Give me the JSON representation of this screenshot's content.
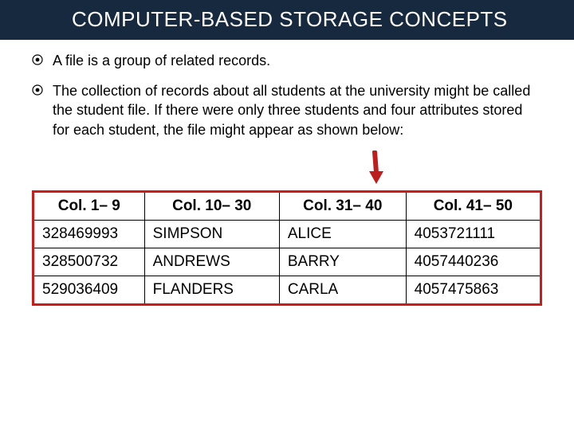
{
  "title": "COMPUTER-BASED STORAGE CONCEPTS",
  "bullets": [
    "A file is a group of related records.",
    "The collection of records about all students at the university might be called the student file. If there were only three students and four attributes stored for each student, the file might appear as shown below:"
  ],
  "table": {
    "headers": [
      "Col. 1– 9",
      "Col. 10– 30",
      "Col. 31– 40",
      "Col. 41– 50"
    ],
    "rows": [
      [
        "328469993",
        "SIMPSON",
        "ALICE",
        "4053721111"
      ],
      [
        "328500732",
        "ANDREWS",
        "BARRY",
        "4057440236"
      ],
      [
        "529036409",
        "FLANDERS",
        "CARLA",
        "4057475863"
      ]
    ]
  }
}
